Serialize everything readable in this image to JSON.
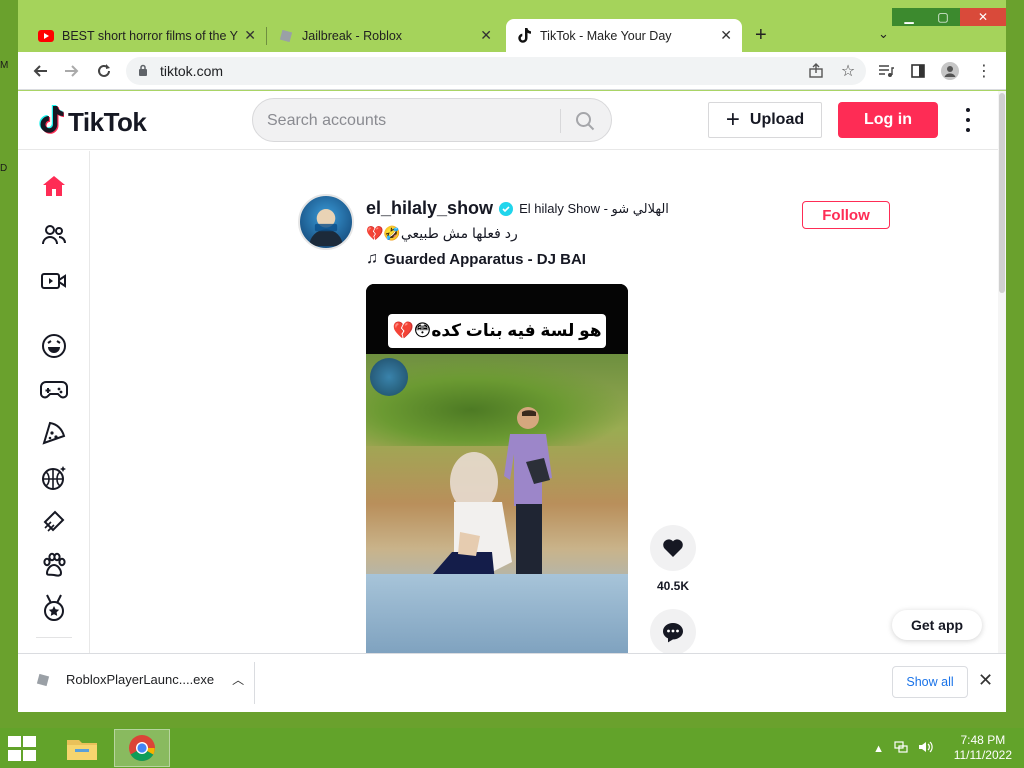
{
  "browser": {
    "tabs": [
      {
        "label": "BEST short horror films of the YEAR",
        "icon": "youtube-icon",
        "active": false
      },
      {
        "label": "Jailbreak - Roblox",
        "icon": "roblox-icon",
        "active": false
      },
      {
        "label": "TikTok - Make Your Day",
        "icon": "tiktok-icon",
        "active": true
      }
    ],
    "url": "tiktok.com"
  },
  "tiktok": {
    "logo": "TikTok",
    "search_placeholder": "Search accounts",
    "upload_label": "Upload",
    "login_label": "Log in",
    "sidebar_icons": [
      "home-icon",
      "following-icon",
      "live-icon",
      "comedy-icon",
      "gaming-icon",
      "food-icon",
      "sports-icon",
      "beauty-icon",
      "animals-icon",
      "achievement-icon"
    ],
    "post": {
      "author": "el_hilaly_show",
      "nickname": "El hilaly Show - الهلالي شو",
      "caption": "💔🤣رد فعلها مش طبيعي",
      "music": "Guarded Apparatus - DJ BAI",
      "follow_label": "Follow",
      "video_overlay_text": "هو لسة فيه بنات كده😳💔",
      "likes": "40.5K"
    },
    "get_app_label": "Get app"
  },
  "downloads": {
    "file": "RobloxPlayerLaunc....exe",
    "show_all_label": "Show all"
  },
  "taskbar": {
    "time": "7:48 PM",
    "date": "11/11/2022"
  },
  "colors": {
    "brand": "#fe2c55",
    "desktop": "#6aa12d",
    "tabstrip": "#a5d35b"
  }
}
